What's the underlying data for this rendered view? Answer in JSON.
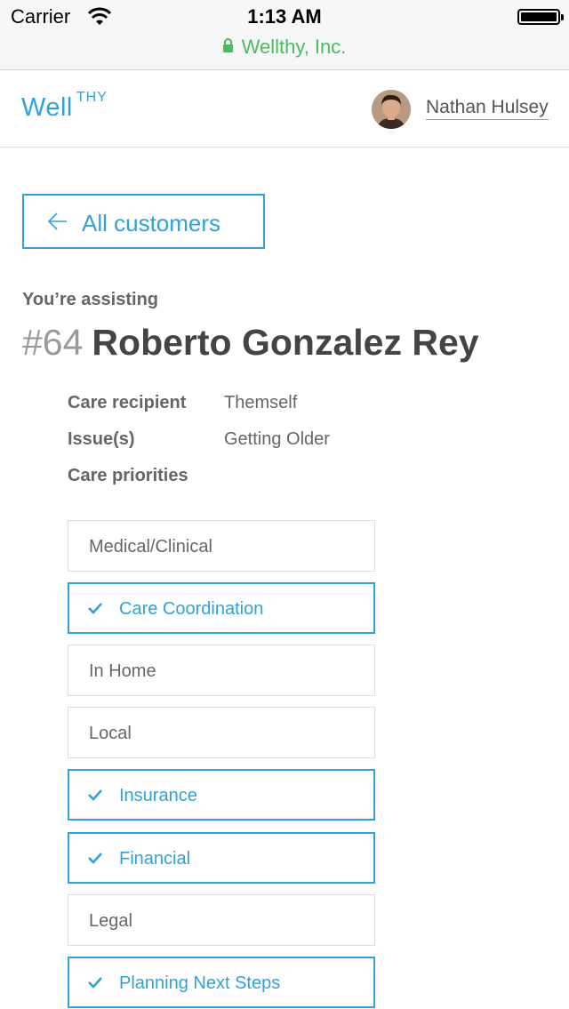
{
  "status_bar": {
    "carrier": "Carrier",
    "time": "1:13 AM",
    "url": "Wellthy, Inc."
  },
  "header": {
    "logo_main": "Well",
    "logo_super": "THY",
    "user_name": "Nathan Hulsey"
  },
  "back_button": {
    "label": "All customers"
  },
  "customer": {
    "assisting_label": "You’re assisting",
    "number": "#64",
    "name": "Roberto Gonzalez Rey"
  },
  "details": [
    {
      "label": "Care recipient",
      "value": "Themself"
    },
    {
      "label": "Issue(s)",
      "value": "Getting Older"
    },
    {
      "label": "Care priorities",
      "value": ""
    }
  ],
  "priorities": [
    {
      "label": "Medical/Clinical",
      "selected": false
    },
    {
      "label": "Care Coordination",
      "selected": true
    },
    {
      "label": "In Home",
      "selected": false
    },
    {
      "label": "Local",
      "selected": false
    },
    {
      "label": "Insurance",
      "selected": true
    },
    {
      "label": "Financial",
      "selected": true
    },
    {
      "label": "Legal",
      "selected": false
    },
    {
      "label": "Planning Next Steps",
      "selected": true
    }
  ],
  "colors": {
    "accent": "#2fa3d9",
    "secure_green": "#4cbb5c",
    "text": "#666666",
    "muted_number": "#999999"
  }
}
